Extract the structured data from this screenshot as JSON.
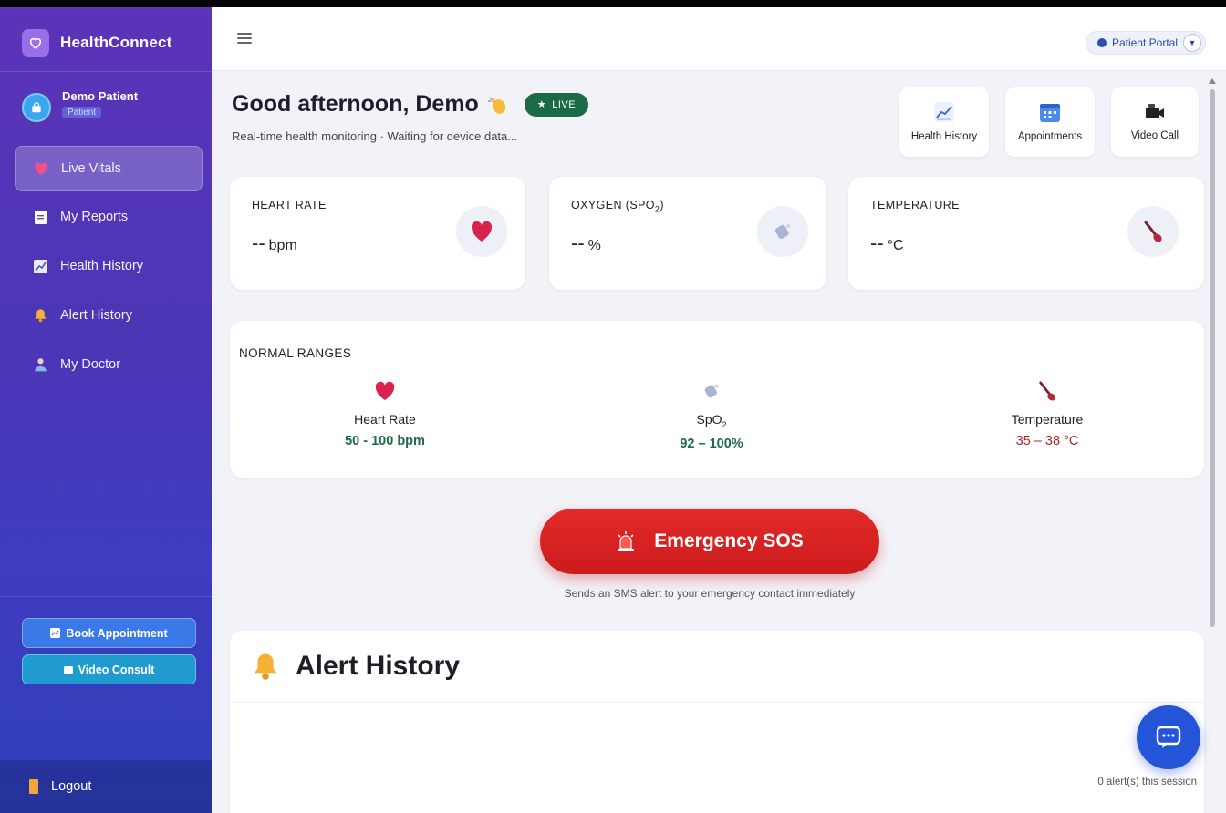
{
  "app": {
    "name": "HealthConnect"
  },
  "user": {
    "name": "Demo Patient",
    "role": "Patient"
  },
  "sidebar": {
    "items": [
      {
        "label": "Live Vitals",
        "icon": "heart-icon",
        "active": true
      },
      {
        "label": "My Reports",
        "icon": "document-icon"
      },
      {
        "label": "Health History",
        "icon": "chart-icon"
      },
      {
        "label": "Alert History",
        "icon": "bell-icon"
      },
      {
        "label": "My Doctor",
        "icon": "doctor-icon"
      }
    ],
    "book_label": "Book Appointment",
    "video_label": "Video Consult",
    "logout_label": "Logout"
  },
  "topbar": {
    "portal_label": "Patient Portal"
  },
  "header": {
    "greeting": "Good afternoon, Demo",
    "live_label": "LIVE",
    "subtitle": "Real-time health monitoring · Waiting for device data..."
  },
  "quick_actions": [
    {
      "label": "Health History",
      "icon": "chart-icon"
    },
    {
      "label": "Appointments",
      "icon": "calendar-icon"
    },
    {
      "label": "Video Call",
      "icon": "video-camera-icon"
    }
  ],
  "vitals": [
    {
      "label": "HEART RATE",
      "value": "--",
      "unit": "bpm",
      "icon": "heart-icon"
    },
    {
      "label_main": "OXYGEN (SPO",
      "label_sub": "2",
      "label_end": ")",
      "value": "--",
      "unit": "%",
      "icon": "oxygen-icon"
    },
    {
      "label": "TEMPERATURE",
      "value": "--",
      "unit": "°C",
      "icon": "thermometer-icon"
    }
  ],
  "ranges": {
    "title": "NORMAL RANGES",
    "items": [
      {
        "name": "Heart Rate",
        "value": "50 - 100 bpm",
        "color": "#1d6b47"
      },
      {
        "name_main": "SpO",
        "name_sub": "2",
        "value": "92 – 100%",
        "color": "#1d6b47"
      },
      {
        "name": "Temperature",
        "value": "35 – 38 °C",
        "color": "#a3272c"
      }
    ]
  },
  "sos": {
    "label": "Emergency SOS",
    "note": "Sends an SMS alert to your emergency contact immediately"
  },
  "alerts": {
    "title": "Alert History",
    "count_text": "0 alert(s) this session"
  },
  "colors": {
    "accent": "#2454d8",
    "sos": "#d92222",
    "live": "#1a6b46",
    "sidebar_top": "#5b34b8"
  }
}
